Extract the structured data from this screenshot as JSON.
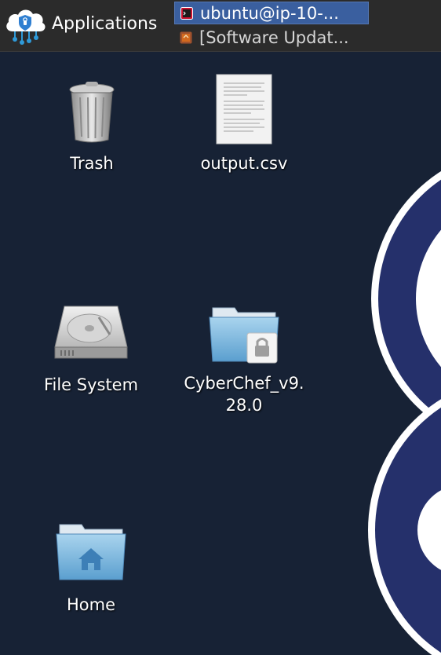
{
  "panel": {
    "app_menu_label": "Applications",
    "tasks": [
      {
        "label": "ubuntu@ip-10-...",
        "icon": "terminal-icon",
        "active": true
      },
      {
        "label": "[Software Updat...",
        "icon": "software-update-icon",
        "active": false
      }
    ]
  },
  "desktop": {
    "icons": [
      {
        "label": "Trash",
        "icon": "trash-icon"
      },
      {
        "label": "output.csv",
        "icon": "document-icon"
      },
      {
        "label": "File System",
        "icon": "hard-drive-icon"
      },
      {
        "label_line1": "CyberChef_v9.",
        "label_line2": "28.0",
        "icon": "locked-folder-icon"
      },
      {
        "label": "Home",
        "icon": "home-folder-icon"
      }
    ]
  },
  "colors": {
    "desktop_bg": "#172235",
    "panel_bg": "#2b2b2b",
    "active_task": "#3a5f9f",
    "wallpaper_ring": "#25306b"
  }
}
